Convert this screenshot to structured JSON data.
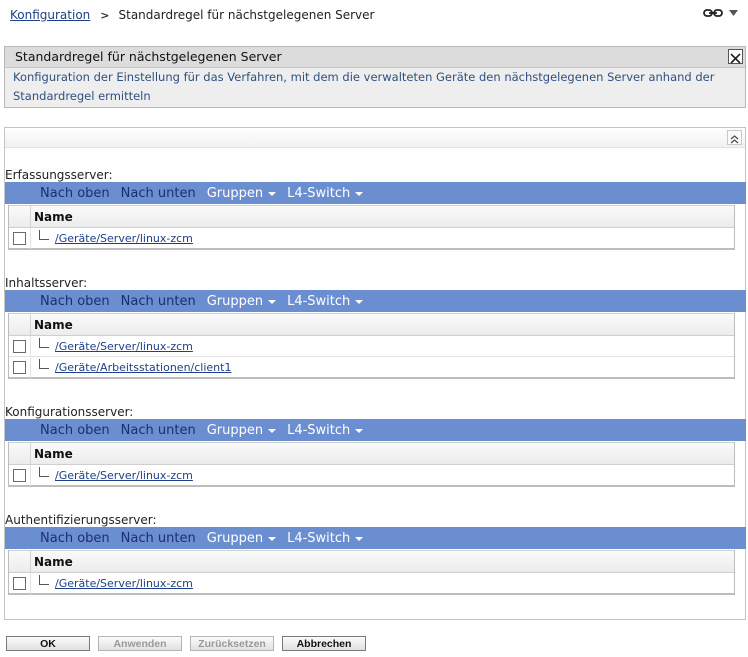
{
  "breadcrumb": {
    "parent": "Konfiguration",
    "separator": ">",
    "current": "Standardregel für nächstgelegenen Server"
  },
  "top_tools": {
    "icons": [
      "link-chain-icon",
      "dropdown-arrow-icon"
    ]
  },
  "info_panel": {
    "title": "Standardregel für nächstgelegenen Server",
    "description": "Konfiguration der Einstellung für das Verfahren, mit dem die verwalteten Geräte den nächstgelegenen Server anhand der Standardregel ermitteln"
  },
  "toolbar": {
    "move_up": "Nach oben",
    "move_down": "Nach unten",
    "groups": "Gruppen",
    "l4switch": "L4-Switch"
  },
  "table_header": "Name",
  "sections": [
    {
      "label": "Erfassungsserver:",
      "rows": [
        "/Geräte/Server/linux-zcm"
      ]
    },
    {
      "label": "Inhaltsserver:",
      "rows": [
        "/Geräte/Server/linux-zcm",
        "/Geräte/Arbeitsstationen/client1"
      ]
    },
    {
      "label": "Konfigurationsserver:",
      "rows": [
        "/Geräte/Server/linux-zcm"
      ]
    },
    {
      "label": "Authentifizierungsserver:",
      "rows": [
        "/Geräte/Server/linux-zcm"
      ]
    }
  ],
  "buttons": {
    "ok": "OK",
    "apply": "Anwenden",
    "reset": "Zurücksetzen",
    "cancel": "Abbrechen"
  },
  "colors": {
    "toolbar_bg": "#6b8ed1",
    "link": "#1f3f88",
    "toolbar_button_text": "#1a2f6e",
    "toolbar_menu_text": "#ffffff"
  }
}
